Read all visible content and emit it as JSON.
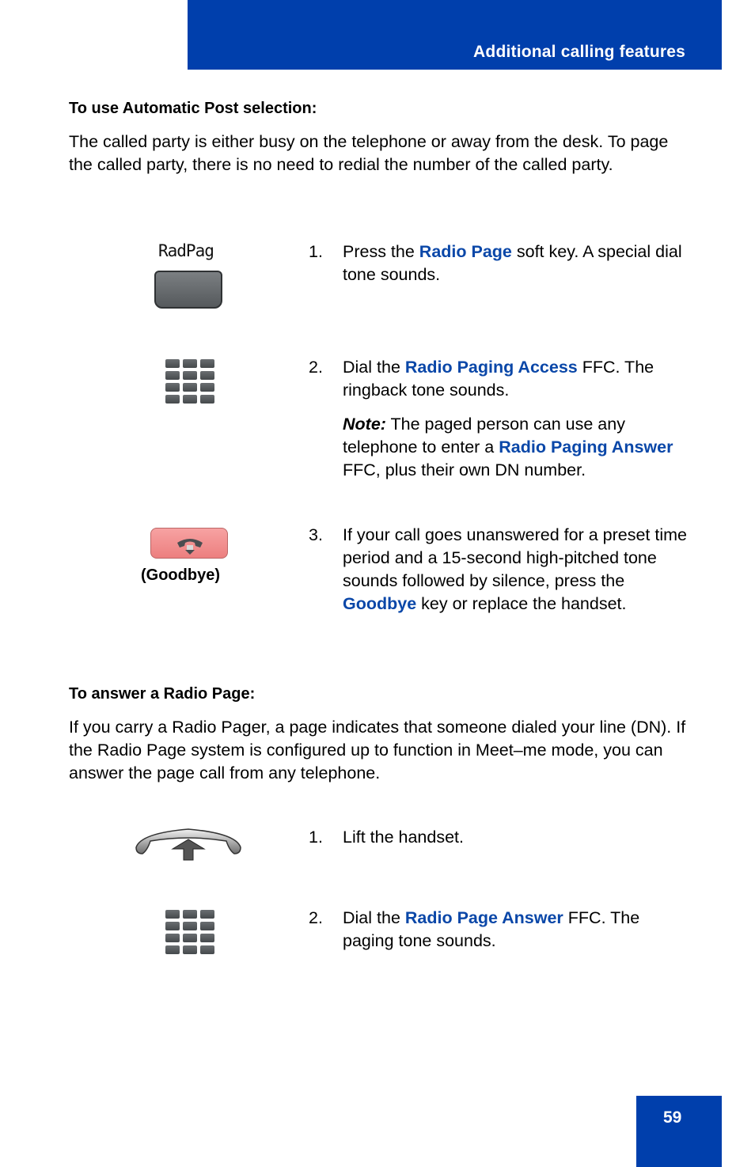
{
  "header": {
    "title": "Additional calling features"
  },
  "section1": {
    "heading": "To use Automatic Post selection:",
    "intro": "The called party is either busy on the telephone or away from the desk. To page the called party, there is no need to redial the number of the called party.",
    "steps": [
      {
        "num": "1.",
        "icon": "softkey-icon",
        "icon_label": "RadPag",
        "pre": "Press the ",
        "key": "Radio Page",
        "post": " soft key. A special dial tone sounds."
      },
      {
        "num": "2.",
        "icon": "dialpad-icon",
        "pre": "Dial the ",
        "key": "Radio Paging Access",
        "post": " FFC. The ringback tone sounds.",
        "note_label": "Note:",
        "note_pre": " The paged person can use any telephone to enter a ",
        "note_key": "Radio Paging Answer",
        "note_post": " FFC, plus their own DN number."
      },
      {
        "num": "3.",
        "icon": "goodbye-icon",
        "icon_label": "(Goodbye)",
        "pre": "If your call goes unanswered for a preset time period and a 15-second high-pitched tone sounds followed by silence, press the ",
        "key": "Goodbye",
        "post": " key or replace the handset."
      }
    ]
  },
  "section2": {
    "heading": "To answer a Radio Page:",
    "intro": "If you carry a Radio Pager, a page indicates that someone dialed your line (DN). If the Radio Page system is configured up to function in Meet–me mode, you can answer the page call from any telephone.",
    "steps": [
      {
        "num": "1.",
        "icon": "lift-handset-icon",
        "text": "Lift the handset."
      },
      {
        "num": "2.",
        "icon": "dialpad-icon",
        "pre": "Dial the ",
        "key": "Radio Page Answer",
        "post": " FFC. The paging tone sounds."
      }
    ]
  },
  "footer": {
    "page_number": "59"
  },
  "colors": {
    "brand_blue": "#003fac",
    "link_blue": "#0a47a8",
    "goodbye_red": "#ec7f7f"
  }
}
